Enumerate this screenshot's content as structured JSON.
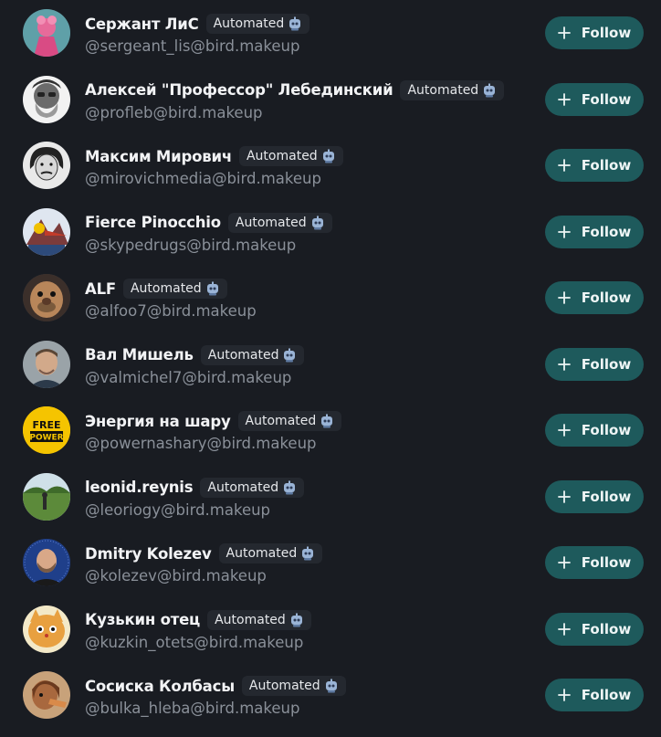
{
  "badge_label": "Automated",
  "bot_icon": "robot-icon",
  "follow_label": "Follow",
  "colors": {
    "background": "#191c22",
    "button": "#1e5a5c",
    "badge": "#24282f",
    "handle": "#8a9099"
  },
  "accounts": [
    {
      "name": "Сержант ЛиС",
      "handle": "@sergeant_lis@bird.makeup"
    },
    {
      "name": "Алексей \"Профессор\" Лебединский",
      "handle": "@profleb@bird.makeup"
    },
    {
      "name": "Максим Мирович",
      "handle": "@mirovichmedia@bird.makeup"
    },
    {
      "name": "Fierce Pinocchio",
      "handle": "@skypedrugs@bird.makeup"
    },
    {
      "name": "ALF",
      "handle": "@alfoo7@bird.makeup"
    },
    {
      "name": "Вал Мишель",
      "handle": "@valmichel7@bird.makeup"
    },
    {
      "name": "Энергия на шару",
      "handle": "@powernashary@bird.makeup",
      "avatar_text": [
        "FREE",
        "POWER"
      ]
    },
    {
      "name": "leonid.reynis",
      "handle": "@leoriogy@bird.makeup"
    },
    {
      "name": "Dmitry Kolezev",
      "handle": "@kolezev@bird.makeup"
    },
    {
      "name": "Кузькин отец",
      "handle": "@kuzkin_otets@bird.makeup"
    },
    {
      "name": "Сосиска Колбасы",
      "handle": "@bulka_hleba@bird.makeup"
    }
  ]
}
